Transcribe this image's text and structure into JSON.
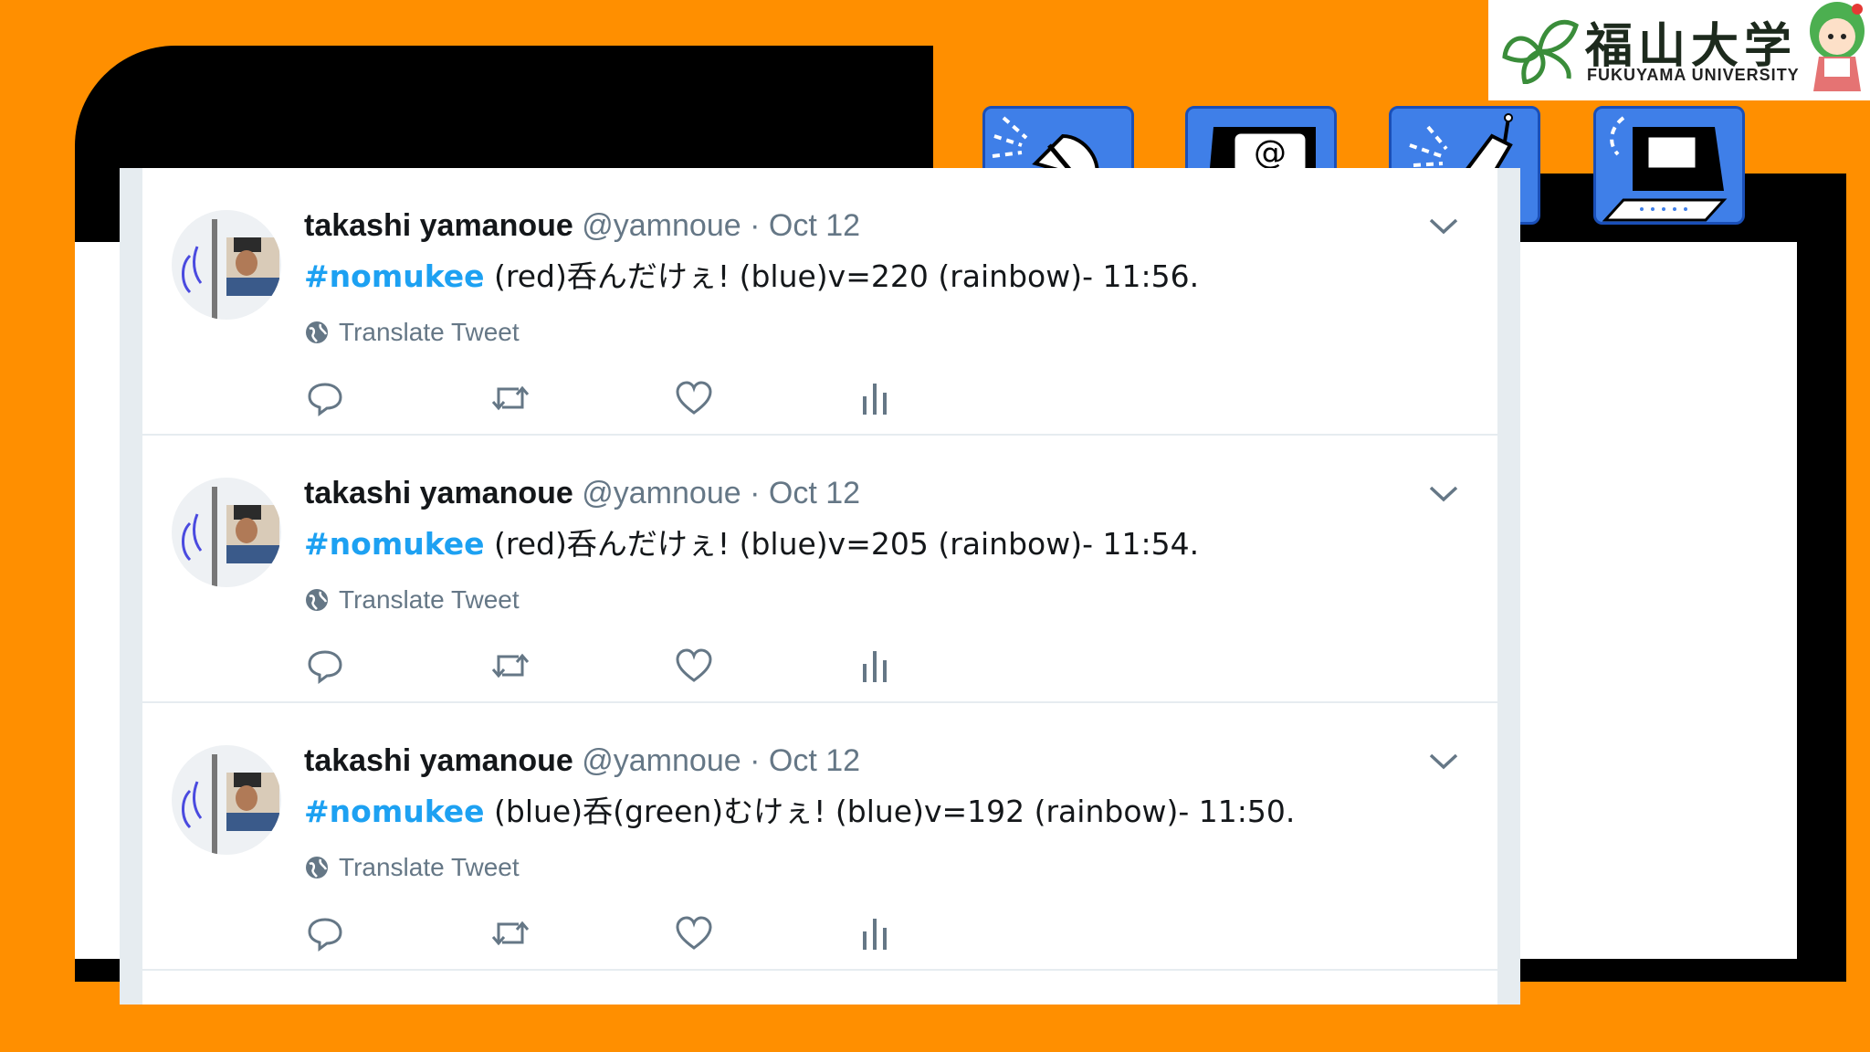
{
  "logo": {
    "title_jp": "福山大学",
    "title_en": "FUKUYAMA UNIVERSITY"
  },
  "nav_icons": [
    "mouse-icon",
    "email-icon",
    "mobile-phone-icon",
    "computer-icon"
  ],
  "colors": {
    "background": "#ff8f00",
    "hashtag": "#1da1f2",
    "icon_button": "#3f7fe8"
  },
  "tweets": [
    {
      "name": "takashi yamanoue",
      "handle": "@yamnoue",
      "separator": "·",
      "date": "Oct 12",
      "hashtag": "#nomukee",
      "text": " (red)呑んだけぇ! (blue)v=220 (rainbow)- 11:56.",
      "translate": "Translate Tweet"
    },
    {
      "name": "takashi yamanoue",
      "handle": "@yamnoue",
      "separator": "·",
      "date": "Oct 12",
      "hashtag": "#nomukee",
      "text": " (red)呑んだけぇ! (blue)v=205 (rainbow)- 11:54.",
      "translate": "Translate Tweet"
    },
    {
      "name": "takashi yamanoue",
      "handle": "@yamnoue",
      "separator": "·",
      "date": "Oct 12",
      "hashtag": "#nomukee",
      "text": " (blue)呑(green)むけぇ! (blue)v=192 (rainbow)- 11:50.",
      "translate": "Translate Tweet"
    }
  ]
}
